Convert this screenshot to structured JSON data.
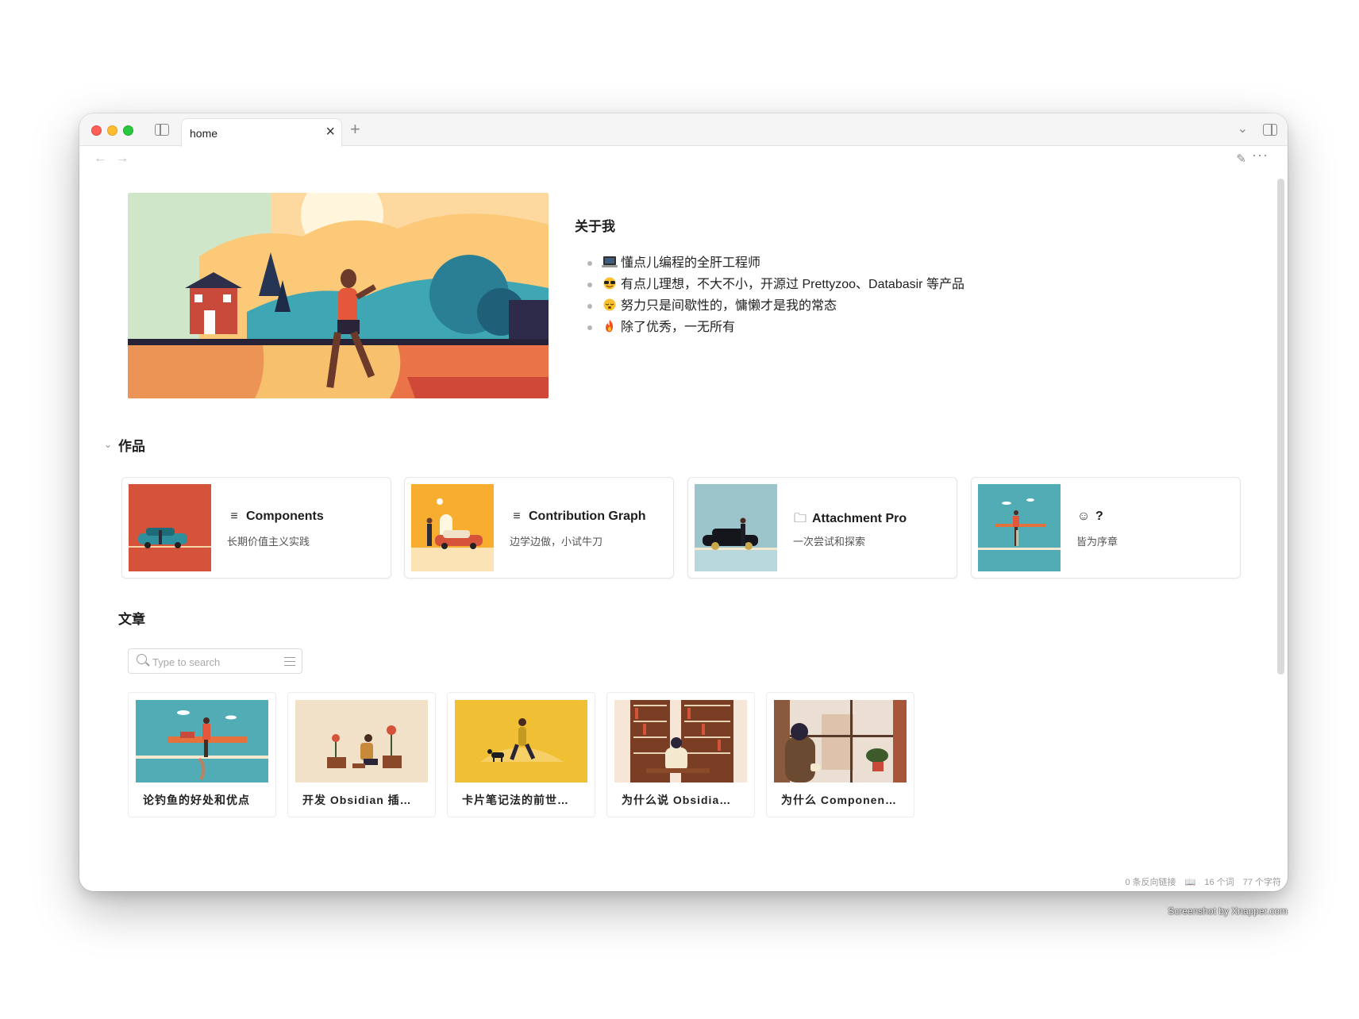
{
  "tab": {
    "title": "home",
    "close_glyph": "×",
    "new_glyph": "+"
  },
  "toolbar": {
    "back_glyph": "←",
    "forward_glyph": "→",
    "edit_glyph": "✎",
    "more_glyph": "···",
    "chevron_glyph": "⌄"
  },
  "about": {
    "title": "关于我",
    "items": [
      {
        "emoji": "laptop",
        "text": "懂点儿编程的全肝工程师"
      },
      {
        "emoji": "sunglasses-face",
        "text": "有点儿理想，不大不小，开源过 Prettyzoo、Databasir 等产品"
      },
      {
        "emoji": "sleepy-face",
        "text": "努力只是间歇性的，慵懒才是我的常态"
      },
      {
        "emoji": "fire",
        "text": "除了优秀，一无所有"
      }
    ]
  },
  "works": {
    "title": "作品",
    "items": [
      {
        "icon": "lines",
        "title": "Components",
        "subtitle": "长期价值主义实践",
        "thumb_color": "#d4533a"
      },
      {
        "icon": "lines",
        "title": "Contribution Graph",
        "subtitle": "边学边做，小试牛刀",
        "thumb_color": "#f7ad30"
      },
      {
        "icon": "folder",
        "title": "Attachment Pro",
        "subtitle": "一次尝试和探索",
        "thumb_color": "#9cc5cb"
      },
      {
        "icon": "smile",
        "title": "?",
        "subtitle": "皆为序章",
        "thumb_color": "#52acb6"
      }
    ]
  },
  "articles": {
    "title": "文章",
    "search_placeholder": "Type to search",
    "items": [
      {
        "title": "论钓鱼的好处和优点",
        "thumb_color": "#52acb6"
      },
      {
        "title": "开发 Obsidian 插…",
        "thumb_color": "#f1e1c8"
      },
      {
        "title": "卡片笔记法的前世…",
        "thumb_color": "#f0bf33"
      },
      {
        "title": "为什么说 Obsidia…",
        "thumb_color": "#f5e6d8"
      },
      {
        "title": "为什么 Componen…",
        "thumb_color": "#eadfd2"
      }
    ]
  },
  "status": {
    "backlinks": "0 条反向链接",
    "words": "16 个词",
    "chars": "77 个字符"
  },
  "watermark": "Screenshot by Xnapper.com"
}
